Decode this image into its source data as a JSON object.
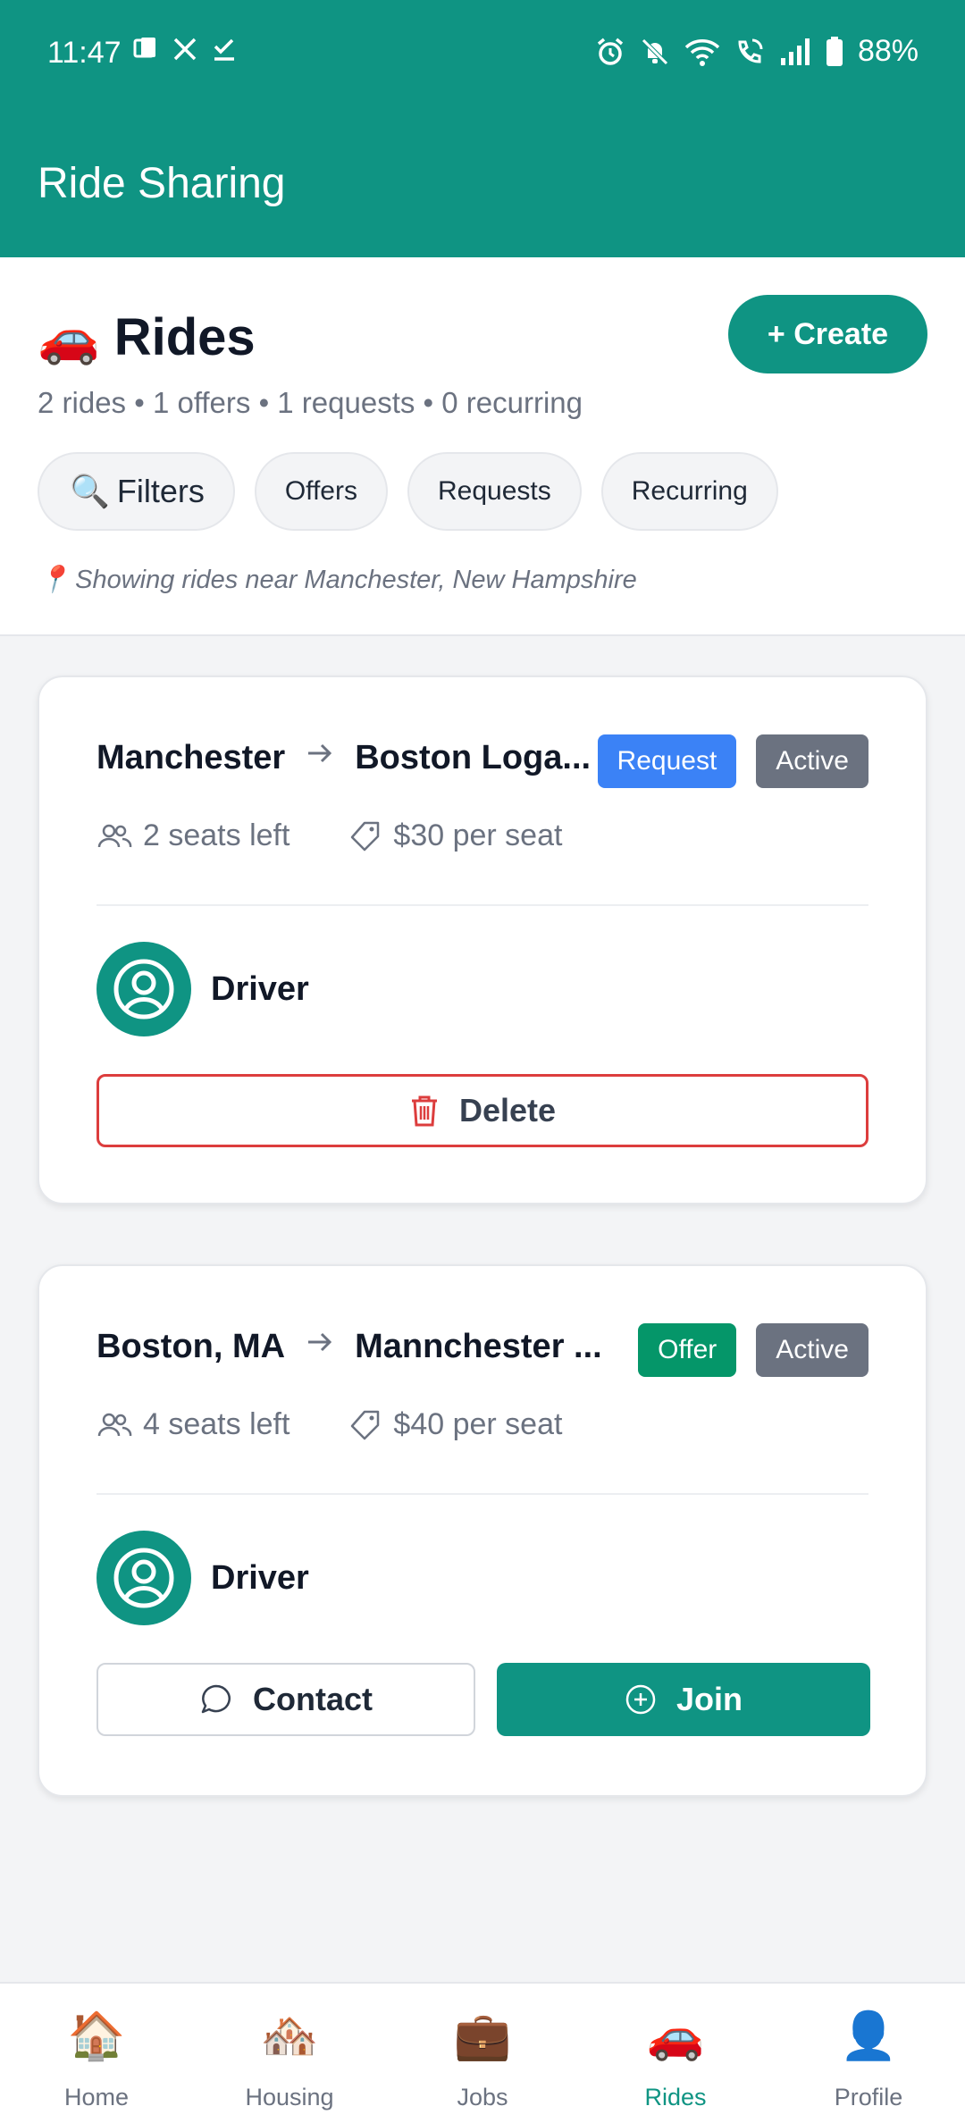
{
  "status_bar": {
    "time": "11:47",
    "battery": "88%"
  },
  "app": {
    "title": "Ride Sharing"
  },
  "header": {
    "icon": "🚗",
    "title": "Rides",
    "create_label": "+ Create",
    "summary": "2 rides • 1 offers • 1 requests • 0 recurring",
    "filters_icon": "🔍",
    "filters_label": "Filters",
    "chips": [
      "Offers",
      "Requests",
      "Recurring"
    ],
    "location_icon": "📍",
    "location_text": "Showing rides near Manchester, New Hampshire"
  },
  "rides": [
    {
      "from": "Manchester",
      "to": "Boston Loga...",
      "type_badge": "Request",
      "status_badge": "Active",
      "seats": "2 seats left",
      "price": "$30 per seat",
      "driver_label": "Driver",
      "action_label": "Delete"
    },
    {
      "from": "Boston, MA",
      "to": "Mannchester ...",
      "type_badge": "Offer",
      "status_badge": "Active",
      "seats": "4 seats left",
      "price": "$40 per seat",
      "driver_label": "Driver",
      "contact_label": "Contact",
      "join_label": "Join"
    }
  ],
  "colors": {
    "primary": "#0f9483",
    "request_badge": "#3b82f6",
    "offer_badge": "#059669",
    "active_badge": "#6b7280",
    "delete_border": "#dc3d3d"
  },
  "bottom_nav": [
    {
      "icon": "🏠",
      "label": "Home"
    },
    {
      "icon": "🏘️",
      "label": "Housing"
    },
    {
      "icon": "💼",
      "label": "Jobs"
    },
    {
      "icon": "🚗",
      "label": "Rides",
      "active": true
    },
    {
      "icon": "👤",
      "label": "Profile"
    }
  ]
}
